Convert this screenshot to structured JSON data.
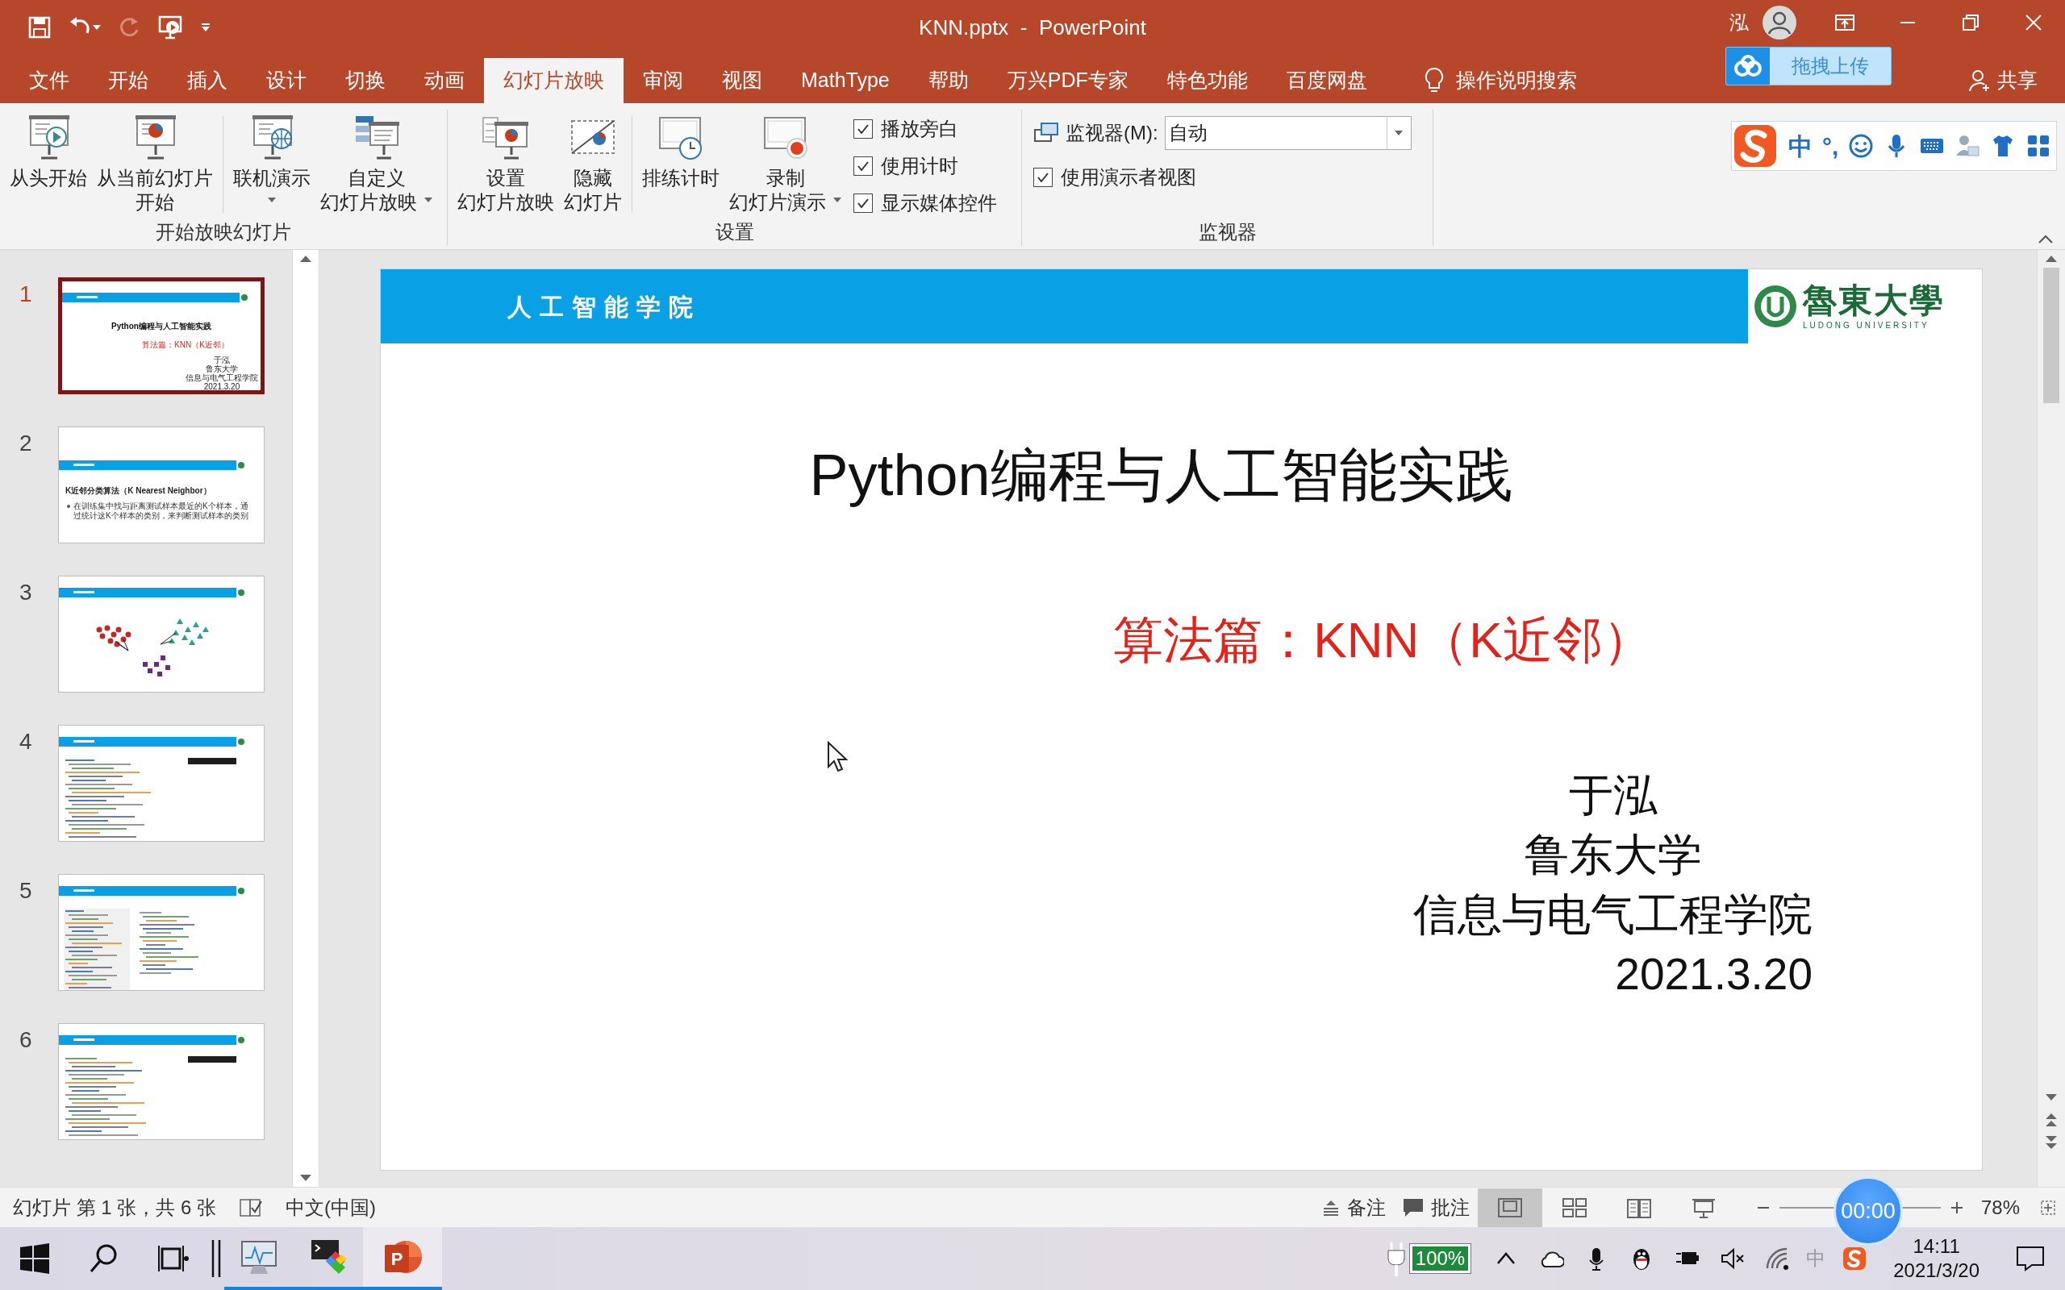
{
  "window": {
    "title": "KNN.pptx  -  PowerPoint",
    "user_name": "泓"
  },
  "cloud_upload": {
    "label": "拖拽上传"
  },
  "tabs": [
    {
      "label": "文件",
      "selected": false
    },
    {
      "label": "开始",
      "selected": false
    },
    {
      "label": "插入",
      "selected": false
    },
    {
      "label": "设计",
      "selected": false
    },
    {
      "label": "切换",
      "selected": false
    },
    {
      "label": "动画",
      "selected": false
    },
    {
      "label": "幻灯片放映",
      "selected": true
    },
    {
      "label": "审阅",
      "selected": false
    },
    {
      "label": "视图",
      "selected": false
    },
    {
      "label": "MathType",
      "selected": false
    },
    {
      "label": "帮助",
      "selected": false
    },
    {
      "label": "万兴PDF专家",
      "selected": false
    },
    {
      "label": "特色功能",
      "selected": false
    },
    {
      "label": "百度网盘",
      "selected": false
    }
  ],
  "tell_me": "操作说明搜索",
  "share": "共享",
  "ribbon_groups": [
    {
      "label": "开始放映幻灯片",
      "controls": [
        {
          "kind": "big",
          "lines": [
            "从头开始"
          ],
          "dropdown": false
        },
        {
          "kind": "big",
          "lines": [
            "从当前幻灯片",
            "开始"
          ],
          "dropdown": false
        },
        {
          "kind": "separator"
        },
        {
          "kind": "big",
          "lines": [
            "联机演示"
          ],
          "dropdown": true
        },
        {
          "kind": "big",
          "lines": [
            "自定义",
            "幻灯片放映"
          ],
          "dropdown": true
        }
      ]
    },
    {
      "label": "设置",
      "controls": [
        {
          "kind": "big",
          "lines": [
            "设置",
            "幻灯片放映"
          ],
          "dropdown": false
        },
        {
          "kind": "big",
          "lines": [
            "隐藏",
            "幻灯片"
          ],
          "dropdown": false
        },
        {
          "kind": "separator"
        },
        {
          "kind": "big",
          "lines": [
            "排练计时"
          ],
          "dropdown": false
        },
        {
          "kind": "big",
          "lines": [
            "录制",
            "幻灯片演示"
          ],
          "dropdown": true
        },
        {
          "kind": "checks",
          "items": [
            {
              "label": "播放旁白",
              "checked": true
            },
            {
              "label": "使用计时",
              "checked": true
            },
            {
              "label": "显示媒体控件",
              "checked": true
            }
          ]
        }
      ]
    },
    {
      "label": "监视器",
      "controls": [
        {
          "kind": "monitor",
          "label": "监视器(M):",
          "value": "自动",
          "checks": [
            {
              "label": "使用演示者视图",
              "checked": true
            }
          ]
        }
      ]
    }
  ],
  "ime_toolbar": {
    "mode": "中",
    "punctuation": "°,"
  },
  "slides": [
    {
      "number": "1",
      "selected": true,
      "kind": "title",
      "title": "Python编程与人工智能实践",
      "subtitle": "算法篇：KNN（K近邻）",
      "lines": [
        "于泓",
        "鲁东大学",
        "信息与电气工程学院",
        "2021.3.20"
      ]
    },
    {
      "number": "2",
      "selected": false,
      "kind": "bullets",
      "title": "K近邻分类算法（K Nearest Neighbor）",
      "bullet": "在训练集中找与距离测试样本最近的K个样本，通过统计这K个样本的类别，来判断测试样本的类别"
    },
    {
      "number": "3",
      "selected": false,
      "kind": "scatter"
    },
    {
      "number": "4",
      "selected": false,
      "kind": "code-console"
    },
    {
      "number": "5",
      "selected": false,
      "kind": "code"
    },
    {
      "number": "6",
      "selected": false,
      "kind": "code-console"
    }
  ],
  "slide": {
    "header": "人工智能学院",
    "logo_name": "魯東大學",
    "logo_subtitle": "LUDONG UNIVERSITY",
    "title": "Python编程与人工智能实践",
    "subtitle": "算法篇：KNN（K近邻）",
    "author_lines": [
      "于泓",
      "鲁东大学",
      "信息与电气工程学院"
    ],
    "date": "2021.3.20"
  },
  "status_bar": {
    "slide_info": "幻灯片 第 1 张，共 6 张",
    "language": "中文(中国)",
    "notes": "备注",
    "comments": "批注",
    "views": [
      {
        "selected": true
      },
      {
        "selected": false
      },
      {
        "selected": false
      },
      {
        "selected": false
      }
    ],
    "zoom": "78%"
  },
  "timer": "00:00",
  "taskbar": {
    "app_badge": "P",
    "battery": "100%",
    "ime": "中",
    "time": "14:11",
    "date": "2021/3/20"
  }
}
